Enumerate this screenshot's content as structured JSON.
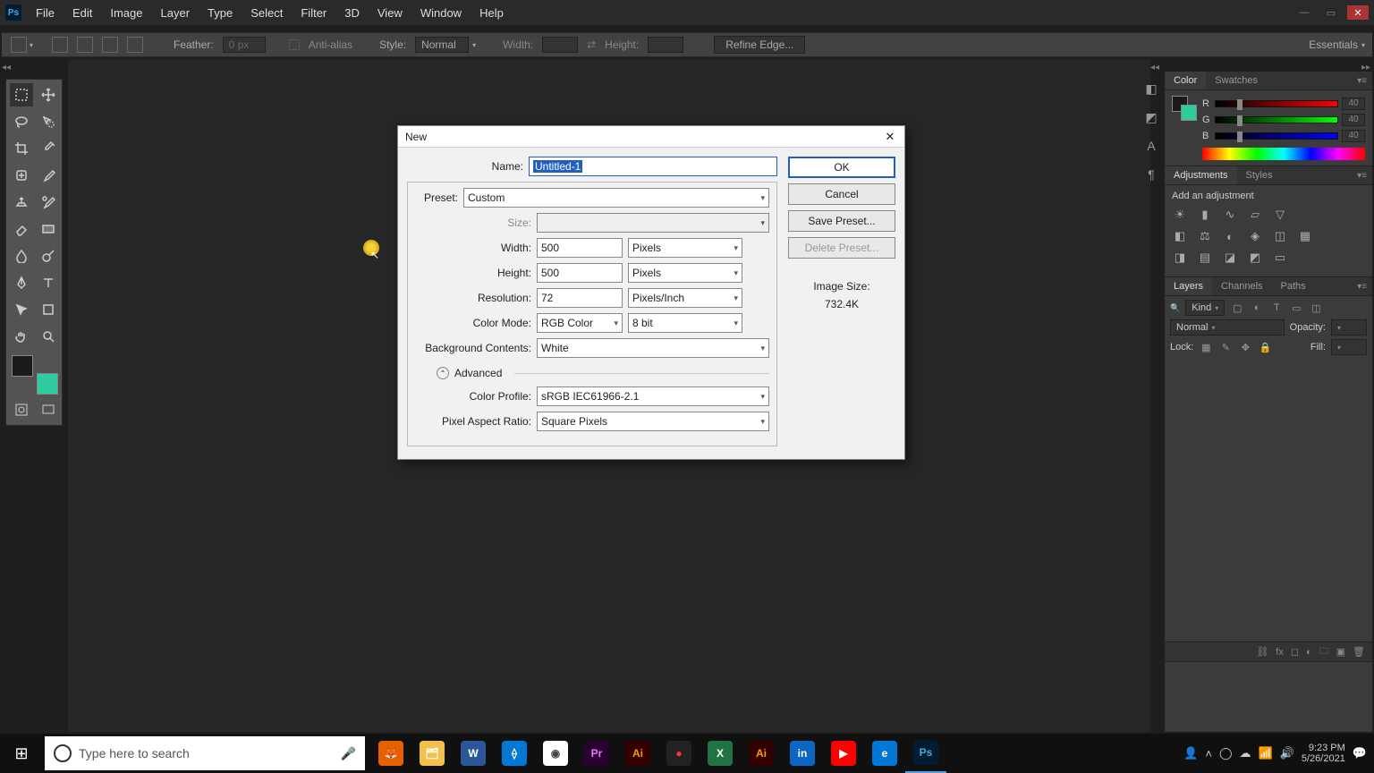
{
  "menubar": [
    "File",
    "Edit",
    "Image",
    "Layer",
    "Type",
    "Select",
    "Filter",
    "3D",
    "View",
    "Window",
    "Help"
  ],
  "optionsbar": {
    "feather_label": "Feather:",
    "feather_value": "0 px",
    "antialias": "Anti-alias",
    "style_label": "Style:",
    "style_value": "Normal",
    "width_label": "Width:",
    "height_label": "Height:",
    "refine": "Refine Edge..."
  },
  "workspace": "Essentials",
  "panels": {
    "color": {
      "tabs": [
        "Color",
        "Swatches"
      ],
      "r": "40",
      "g": "40",
      "b": "40"
    },
    "adjustments": {
      "tabs": [
        "Adjustments",
        "Styles"
      ],
      "hint": "Add an adjustment"
    },
    "layers": {
      "tabs": [
        "Layers",
        "Channels",
        "Paths"
      ],
      "kind": "Kind",
      "mode": "Normal",
      "opacity_label": "Opacity:",
      "lock_label": "Lock:",
      "fill_label": "Fill:"
    }
  },
  "dialog": {
    "title": "New",
    "name_label": "Name:",
    "name_value": "Untitled-1",
    "preset_label": "Preset:",
    "preset_value": "Custom",
    "size_label": "Size:",
    "width_label": "Width:",
    "width_value": "500",
    "width_unit": "Pixels",
    "height_label": "Height:",
    "height_value": "500",
    "height_unit": "Pixels",
    "res_label": "Resolution:",
    "res_value": "72",
    "res_unit": "Pixels/Inch",
    "cmode_label": "Color Mode:",
    "cmode_value": "RGB Color",
    "cdepth_value": "8 bit",
    "bg_label": "Background Contents:",
    "bg_value": "White",
    "adv": "Advanced",
    "cprofile_label": "Color Profile:",
    "cprofile_value": "sRGB IEC61966-2.1",
    "par_label": "Pixel Aspect Ratio:",
    "par_value": "Square Pixels",
    "ok": "OK",
    "cancel": "Cancel",
    "save_preset": "Save Preset...",
    "delete_preset": "Delete Preset...",
    "isize_label": "Image Size:",
    "isize_value": "732.4K"
  },
  "taskbar": {
    "search_placeholder": "Type here to search",
    "time": "9:23 PM",
    "date": "5/26/2021"
  }
}
